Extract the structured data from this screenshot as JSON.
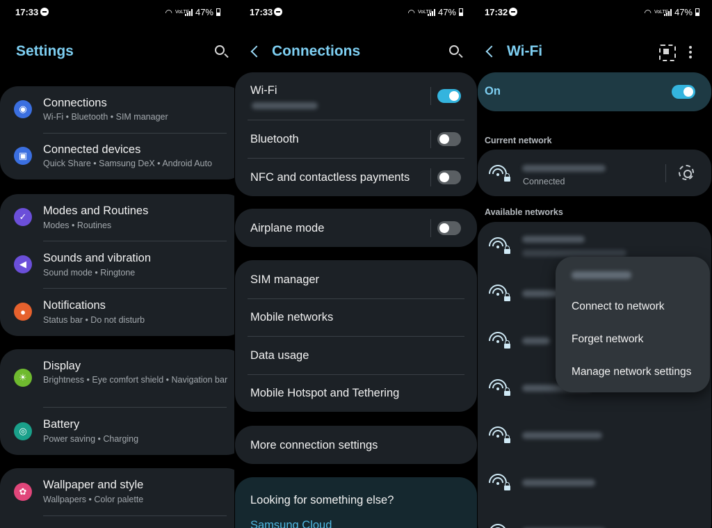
{
  "status_bars": [
    {
      "time": "17:33",
      "battery": "47%",
      "network": "VoLTE"
    },
    {
      "time": "17:33",
      "battery": "47%",
      "network": "VoLTE"
    },
    {
      "time": "17:32",
      "battery": "47%",
      "network": "VoLTE"
    }
  ],
  "settings": {
    "title": "Settings",
    "groups": [
      {
        "items": [
          {
            "title": "Connections",
            "subtitle": "Wi-Fi  •  Bluetooth  •  SIM manager",
            "icon": "wifi-icon",
            "color": "#3b6fe0"
          },
          {
            "title": "Connected devices",
            "subtitle": "Quick Share  •  Samsung DeX  •  Android Auto",
            "icon": "devices-icon",
            "color": "#3b6fe0"
          }
        ]
      },
      {
        "items": [
          {
            "title": "Modes and Routines",
            "subtitle": "Modes  •  Routines",
            "icon": "check-circle-icon",
            "color": "#6b4fd9"
          },
          {
            "title": "Sounds and vibration",
            "subtitle": "Sound mode  •  Ringtone",
            "icon": "speaker-icon",
            "color": "#6b4fd9"
          },
          {
            "title": "Notifications",
            "subtitle": "Status bar  •  Do not disturb",
            "icon": "bell-icon",
            "color": "#e6612d"
          }
        ]
      },
      {
        "items": [
          {
            "title": "Display",
            "subtitle": "Brightness  •  Eye comfort shield  •  Navigation bar",
            "icon": "sun-icon",
            "color": "#6fba2f"
          },
          {
            "title": "Battery",
            "subtitle": "Power saving  •  Charging",
            "icon": "battery-icon",
            "color": "#1aa08a"
          }
        ]
      },
      {
        "items": [
          {
            "title": "Wallpaper and style",
            "subtitle": "Wallpapers  •  Color palette",
            "icon": "wallpaper-icon",
            "color": "#e0467a"
          }
        ]
      }
    ]
  },
  "connections": {
    "title": "Connections",
    "group1": [
      {
        "title": "Wi-Fi",
        "toggle": "on"
      },
      {
        "title": "Bluetooth",
        "toggle": "off"
      },
      {
        "title": "NFC and contactless payments",
        "toggle": "off"
      }
    ],
    "airplane": {
      "title": "Airplane mode",
      "toggle": "off"
    },
    "group2": [
      "SIM manager",
      "Mobile networks",
      "Data usage",
      "Mobile Hotspot and Tethering"
    ],
    "more": "More connection settings",
    "looking": {
      "title": "Looking for something else?",
      "link": "Samsung Cloud"
    }
  },
  "wifi": {
    "title": "Wi-Fi",
    "master": {
      "label": "On",
      "toggle": "on"
    },
    "current_label": "Current network",
    "current_status": "Connected",
    "available_label": "Available networks",
    "popup_items": [
      "Connect to network",
      "Forget network",
      "Manage network settings"
    ]
  },
  "colors": {
    "accent": "#7ecff2",
    "toggle_on": "#34b4de",
    "card": "#1c2126",
    "popup": "#30363b"
  }
}
